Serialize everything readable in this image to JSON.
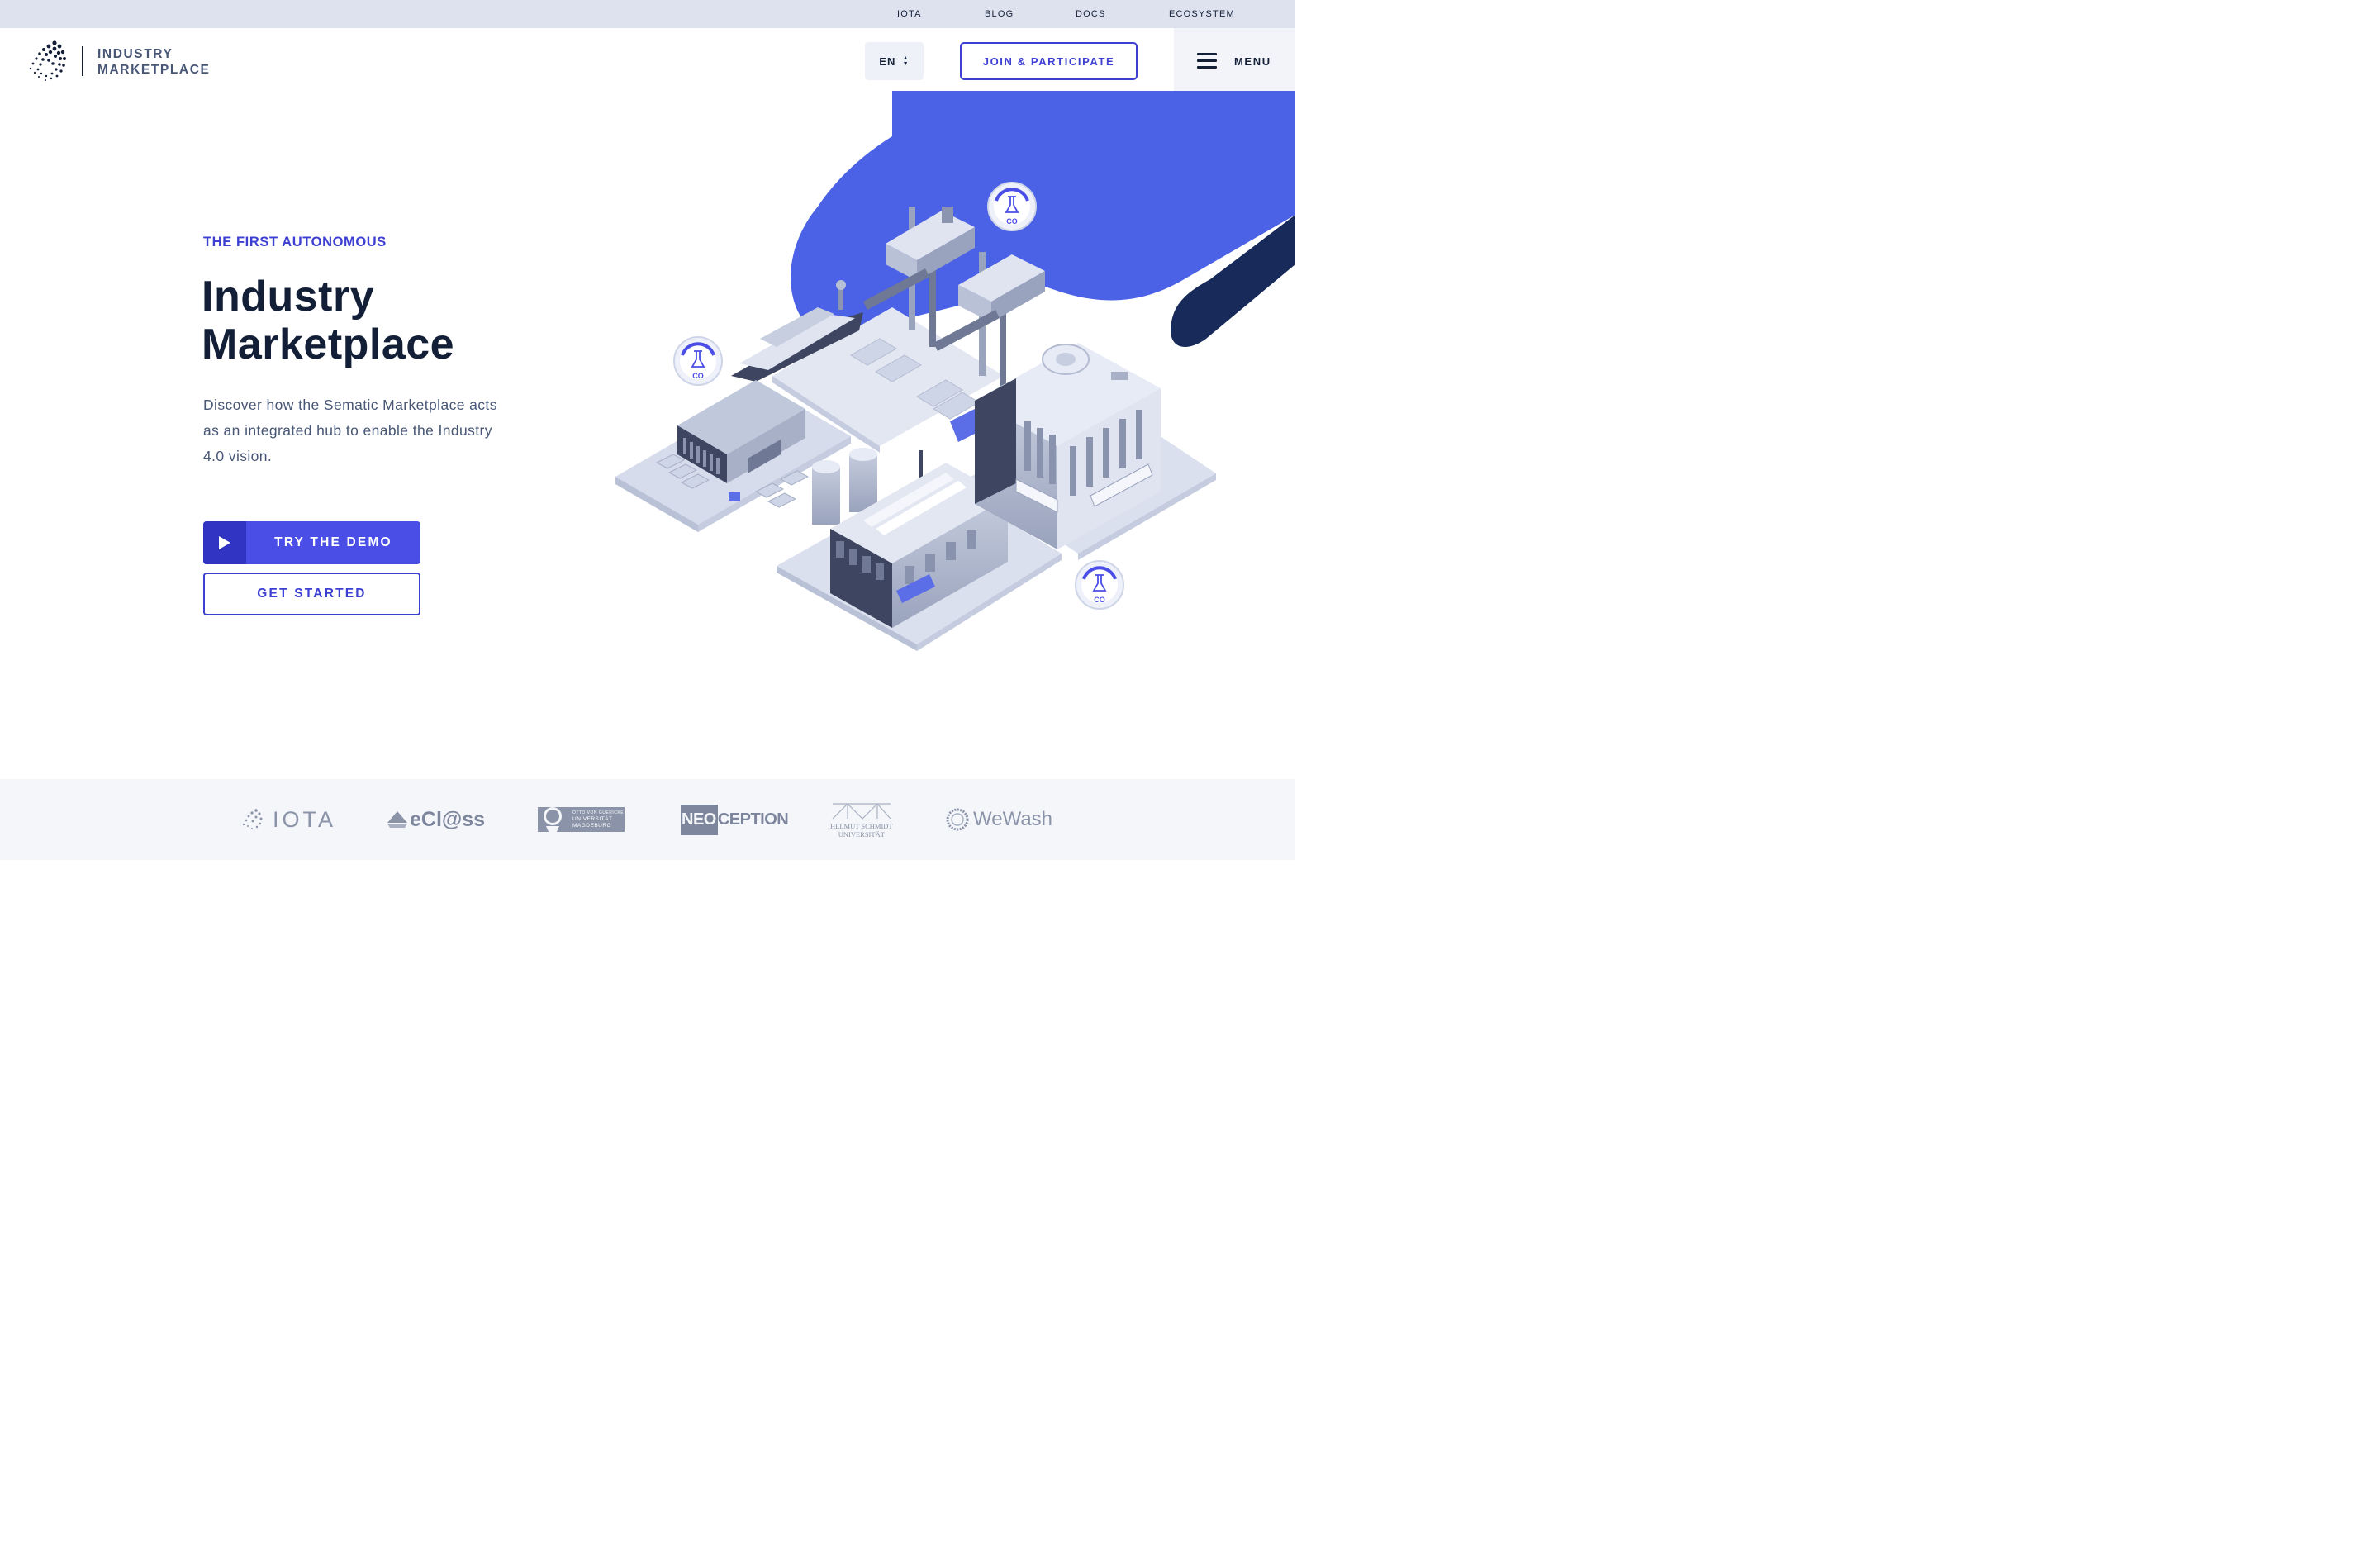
{
  "topnav": {
    "items": [
      "IOTA",
      "BLOG",
      "DOCS",
      "ECOSYSTEM"
    ]
  },
  "header": {
    "brand_line1": "INDUSTRY",
    "brand_line2": "MARKETPLACE",
    "language": "EN",
    "join_label": "JOIN & PARTICIPATE",
    "menu_label": "MENU"
  },
  "hero": {
    "eyebrow": "THE FIRST AUTONOMOUS",
    "title_line1": "Industry",
    "title_line2": "Marketplace",
    "description": "Discover how the Sematic Marketplace acts as an integrated hub to enable the Industry 4.0 vision.",
    "demo_label": "TRY THE DEMO",
    "start_label": "GET STARTED"
  },
  "illustration": {
    "sensor_label": "CO"
  },
  "partners": {
    "iota": "IOTA",
    "eclass": "eCl@ss",
    "ovgu_line1": "OTTO VON GUERICKE",
    "ovgu_line2": "UNIVERSITÄT",
    "ovgu_line3": "MAGDEBURG",
    "neoception_a": "NEO",
    "neoception_b": "CEPTION",
    "hsu_line1": "HELMUT SCHMIDT",
    "hsu_line2": "UNIVERSITÄT",
    "wewash": "WeWash"
  },
  "colors": {
    "accent": "#3d3fd3",
    "accent_fill": "#4a4ee6",
    "navy": "#131f37",
    "topbar_bg": "#dde2ee"
  }
}
